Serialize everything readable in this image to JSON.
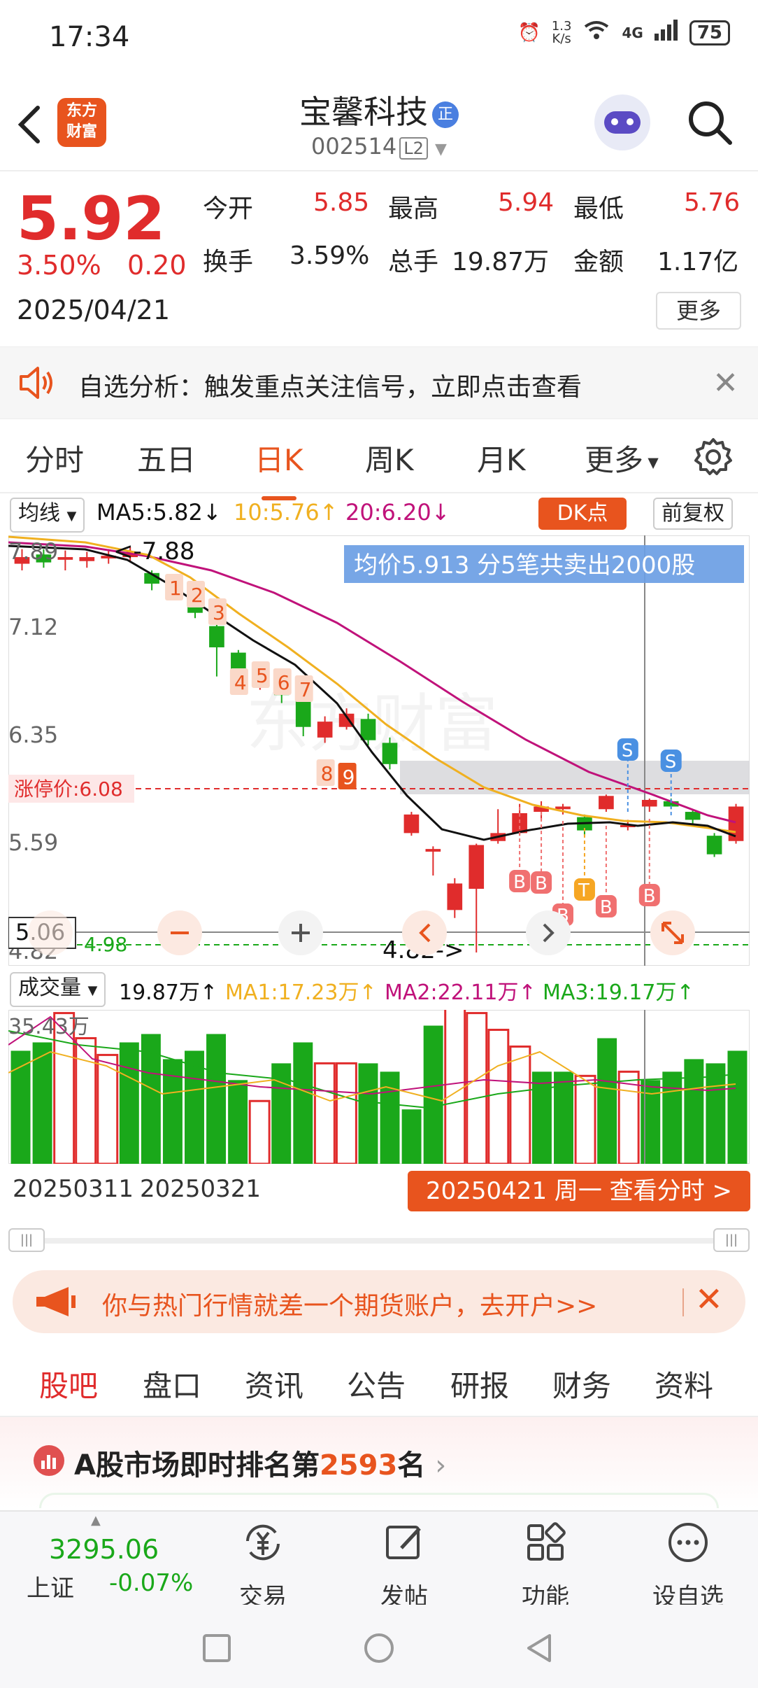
{
  "status_bar": {
    "time": "17:34",
    "net_speed_top": "1.3",
    "net_speed_unit": "K/s",
    "network": "4G",
    "battery": "75"
  },
  "header": {
    "logo_text": "东方\n财富",
    "stock_name": "宝馨科技",
    "badge": "正",
    "stock_code": "002514",
    "level": "L2"
  },
  "quote": {
    "price": "5.92",
    "change_pct": "3.50%",
    "change": "0.20",
    "date": "2025/04/21",
    "stats": [
      {
        "label": "今开",
        "value": "5.85",
        "color": "#e02c2c"
      },
      {
        "label": "最高",
        "value": "5.94",
        "color": "#e02c2c"
      },
      {
        "label": "最低",
        "value": "5.76",
        "color": "#e02c2c"
      },
      {
        "label": "换手",
        "value": "3.59%",
        "color": "#222222"
      },
      {
        "label": "总手",
        "value": "19.87万",
        "color": "#222222"
      },
      {
        "label": "金额",
        "value": "1.17亿",
        "color": "#222222"
      }
    ],
    "more_label": "更多"
  },
  "notice": {
    "text": "自选分析：触发重点关注信号，立即点击查看"
  },
  "chart_tabs": [
    "分时",
    "五日",
    "日K",
    "周K",
    "月K",
    "更多"
  ],
  "ma_row": {
    "selector": "均线",
    "ma5": "MA5:5.82↓",
    "ma10": "10:5.76↑",
    "ma20": "20:6.20↓",
    "dk_label": "DK点",
    "adjust_label": "前复权"
  },
  "kline": {
    "y_labels": [
      "7.89",
      "7.12",
      "6.35",
      "5.59",
      "4.82"
    ],
    "high_marker": "7.88",
    "low_marker": "4.82->",
    "limit_label": "涨停价:6.08",
    "tooltip": "均价5.913  分5笔共卖出2000股",
    "cursor_price": "5.06",
    "support_label": "4.98",
    "digits": [
      "1",
      "2",
      "3",
      "4",
      "5",
      "6",
      "7",
      "8",
      "9"
    ],
    "signal_b": "B",
    "signal_t": "T",
    "signal_s": "S"
  },
  "volume": {
    "selector": "成交量",
    "total": "19.87万↑",
    "ma1": "MA1:17.23万↑",
    "ma2": "MA2:22.11万↑",
    "ma3": "MA3:19.17万↑",
    "max_label": "35.43万"
  },
  "dates": {
    "d1": "20250311",
    "d2": "20250321",
    "button": "20250421 周一 查看分时 >"
  },
  "ad": {
    "text": "你与热门行情就差一个期货账户，去开户>>"
  },
  "sub_tabs": [
    "股吧",
    "盘口",
    "资讯",
    "公告",
    "研报",
    "财务",
    "资料"
  ],
  "rank": {
    "prefix": "A股市场即时排名第",
    "number": "2593",
    "suffix": "名"
  },
  "bottom_bar": {
    "index_value": "3295.06",
    "index_name": "上证",
    "index_change": "-0.07%",
    "items": [
      "交易",
      "发帖",
      "功能",
      "设自选"
    ]
  },
  "colors": {
    "accent": "#e8541e",
    "up": "#e02c2c",
    "down": "#1aa81a",
    "ma5": "#111111",
    "ma10": "#f0b020",
    "ma20": "#c0127a"
  },
  "chart_data": {
    "type": "candlestick",
    "y_ticks": [
      7.89,
      7.12,
      6.35,
      5.59,
      4.82
    ],
    "ylim": [
      4.82,
      7.89
    ],
    "candles": [
      {
        "o": 7.75,
        "c": 7.8,
        "h": 7.86,
        "l": 7.7
      },
      {
        "o": 7.82,
        "c": 7.76,
        "h": 7.86,
        "l": 7.72
      },
      {
        "o": 7.78,
        "c": 7.8,
        "h": 7.85,
        "l": 7.7
      },
      {
        "o": 7.77,
        "c": 7.8,
        "h": 7.84,
        "l": 7.72
      },
      {
        "o": 7.79,
        "c": 7.81,
        "h": 7.86,
        "l": 7.75
      },
      {
        "o": 7.8,
        "c": 7.84,
        "h": 7.88,
        "l": 7.76
      },
      {
        "o": 7.68,
        "c": 7.6,
        "h": 7.7,
        "l": 7.55
      },
      {
        "o": 7.58,
        "c": 7.55,
        "h": 7.62,
        "l": 7.5
      },
      {
        "o": 7.5,
        "c": 7.38,
        "h": 7.52,
        "l": 7.34
      },
      {
        "o": 7.28,
        "c": 7.12,
        "h": 7.3,
        "l": 6.9
      },
      {
        "o": 7.08,
        "c": 6.92,
        "h": 7.1,
        "l": 6.85
      },
      {
        "o": 6.92,
        "c": 6.94,
        "h": 7.0,
        "l": 6.8
      },
      {
        "o": 6.88,
        "c": 6.76,
        "h": 6.92,
        "l": 6.7
      },
      {
        "o": 6.72,
        "c": 6.52,
        "h": 6.74,
        "l": 6.45
      },
      {
        "o": 6.44,
        "c": 6.56,
        "h": 6.6,
        "l": 6.4
      },
      {
        "o": 6.52,
        "c": 6.62,
        "h": 6.66,
        "l": 6.5
      },
      {
        "o": 6.58,
        "c": 6.42,
        "h": 6.62,
        "l": 6.38
      },
      {
        "o": 6.4,
        "c": 6.24,
        "h": 6.44,
        "l": 6.2
      },
      {
        "o": 5.72,
        "c": 5.86,
        "h": 5.88,
        "l": 5.7
      },
      {
        "o": 5.58,
        "c": 5.6,
        "h": 5.62,
        "l": 5.4
      },
      {
        "o": 5.14,
        "c": 5.34,
        "h": 5.38,
        "l": 5.08
      },
      {
        "o": 5.3,
        "c": 5.63,
        "h": 5.64,
        "l": 4.82
      },
      {
        "o": 5.66,
        "c": 5.72,
        "h": 5.9,
        "l": 5.64
      },
      {
        "o": 5.72,
        "c": 5.87,
        "h": 5.94,
        "l": 5.7
      },
      {
        "o": 5.88,
        "c": 5.92,
        "h": 5.96,
        "l": 5.82
      },
      {
        "o": 5.9,
        "c": 5.92,
        "h": 5.94,
        "l": 5.86
      },
      {
        "o": 5.84,
        "c": 5.74,
        "h": 5.86,
        "l": 5.7
      },
      {
        "o": 5.9,
        "c": 6.0,
        "h": 6.01,
        "l": 5.88
      },
      {
        "o": 5.78,
        "c": 5.78,
        "h": 5.82,
        "l": 5.74
      },
      {
        "o": 5.92,
        "c": 5.97,
        "h": 5.98,
        "l": 5.88
      },
      {
        "o": 5.96,
        "c": 5.92,
        "h": 5.98,
        "l": 5.9
      },
      {
        "o": 5.88,
        "c": 5.82,
        "h": 5.9,
        "l": 5.78
      },
      {
        "o": 5.7,
        "c": 5.56,
        "h": 5.72,
        "l": 5.54
      },
      {
        "o": 5.66,
        "c": 5.92,
        "h": 5.94,
        "l": 5.64
      }
    ],
    "volume_max": 35.43,
    "volumes": [
      27,
      29,
      36,
      30,
      26,
      29,
      31,
      25,
      27,
      31,
      20,
      15,
      24,
      29,
      24,
      24,
      24,
      22,
      13,
      33,
      38,
      36,
      32,
      28,
      22,
      22,
      21,
      30,
      22,
      20,
      22,
      25,
      24,
      27
    ],
    "volume_up": [
      0,
      0,
      1,
      1,
      1,
      0,
      0,
      0,
      0,
      0,
      0,
      1,
      0,
      0,
      1,
      1,
      0,
      0,
      0,
      0,
      1,
      1,
      1,
      1,
      0,
      0,
      1,
      0,
      1,
      0,
      0,
      0,
      0,
      0
    ]
  }
}
